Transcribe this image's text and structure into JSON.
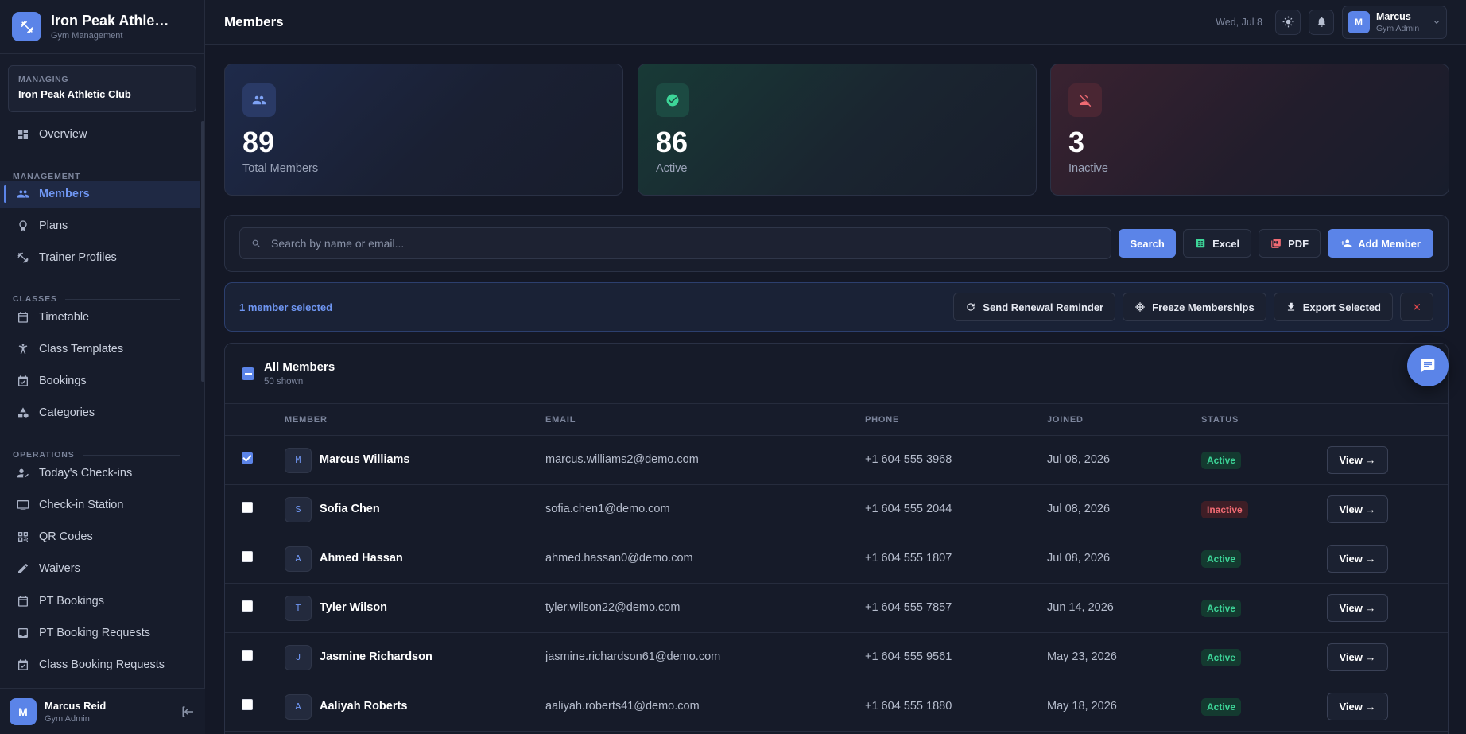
{
  "brand": {
    "name": "Iron Peak Athle…",
    "subtitle": "Gym Management"
  },
  "managing": {
    "label": "MANAGING",
    "name": "Iron Peak Athletic Club"
  },
  "sidebar": {
    "overview": "Overview",
    "sections": {
      "management": "MANAGEMENT",
      "classes": "CLASSES",
      "operations": "OPERATIONS"
    },
    "items": {
      "members": "Members",
      "plans": "Plans",
      "trainers": "Trainer Profiles",
      "timetable": "Timetable",
      "class_templates": "Class Templates",
      "bookings": "Bookings",
      "categories": "Categories",
      "checkins": "Today's Check-ins",
      "checkin_station": "Check-in Station",
      "qr_codes": "QR Codes",
      "waivers": "Waivers",
      "pt_bookings": "PT Bookings",
      "pt_requests": "PT Booking Requests",
      "class_requests": "Class Booking Requests"
    },
    "user": {
      "initial": "M",
      "name": "Marcus Reid",
      "role": "Gym Admin"
    }
  },
  "topbar": {
    "title": "Members",
    "date": "Wed, Jul 8",
    "profile": {
      "initial": "M",
      "name": "Marcus",
      "role": "Gym Admin"
    }
  },
  "stats": {
    "total": {
      "value": "89",
      "label": "Total Members"
    },
    "active": {
      "value": "86",
      "label": "Active"
    },
    "inactive": {
      "value": "3",
      "label": "Inactive"
    }
  },
  "search": {
    "placeholder": "Search by name or email...",
    "search_label": "Search",
    "excel_label": "Excel",
    "pdf_label": "PDF",
    "add_label": "Add Member"
  },
  "selection": {
    "text": "1 member selected",
    "renewal_label": "Send Renewal Reminder",
    "freeze_label": "Freeze Memberships",
    "export_label": "Export Selected"
  },
  "table": {
    "title": "All Members",
    "subtitle": "50 shown",
    "columns": {
      "member": "MEMBER",
      "email": "EMAIL",
      "phone": "PHONE",
      "joined": "JOINED",
      "status": "STATUS"
    },
    "view_label": "View →",
    "rows": [
      {
        "initial": "M",
        "name": "Marcus Williams",
        "email": "marcus.williams2@demo.com",
        "phone": "+1 604 555 3968",
        "joined": "Jul 08, 2026",
        "status": "Active",
        "checked": true
      },
      {
        "initial": "S",
        "name": "Sofia Chen",
        "email": "sofia.chen1@demo.com",
        "phone": "+1 604 555 2044",
        "joined": "Jul 08, 2026",
        "status": "Inactive",
        "checked": false
      },
      {
        "initial": "A",
        "name": "Ahmed Hassan",
        "email": "ahmed.hassan0@demo.com",
        "phone": "+1 604 555 1807",
        "joined": "Jul 08, 2026",
        "status": "Active",
        "checked": false
      },
      {
        "initial": "T",
        "name": "Tyler Wilson",
        "email": "tyler.wilson22@demo.com",
        "phone": "+1 604 555 7857",
        "joined": "Jun 14, 2026",
        "status": "Active",
        "checked": false
      },
      {
        "initial": "J",
        "name": "Jasmine Richardson",
        "email": "jasmine.richardson61@demo.com",
        "phone": "+1 604 555 9561",
        "joined": "May 23, 2026",
        "status": "Active",
        "checked": false
      },
      {
        "initial": "A",
        "name": "Aaliyah Roberts",
        "email": "aaliyah.roberts41@demo.com",
        "phone": "+1 604 555 1880",
        "joined": "May 18, 2026",
        "status": "Active",
        "checked": false
      }
    ]
  },
  "colors": {
    "accent": "#5b84e8",
    "active": "#3dd598",
    "inactive": "#f06b73",
    "background": "#141826"
  }
}
